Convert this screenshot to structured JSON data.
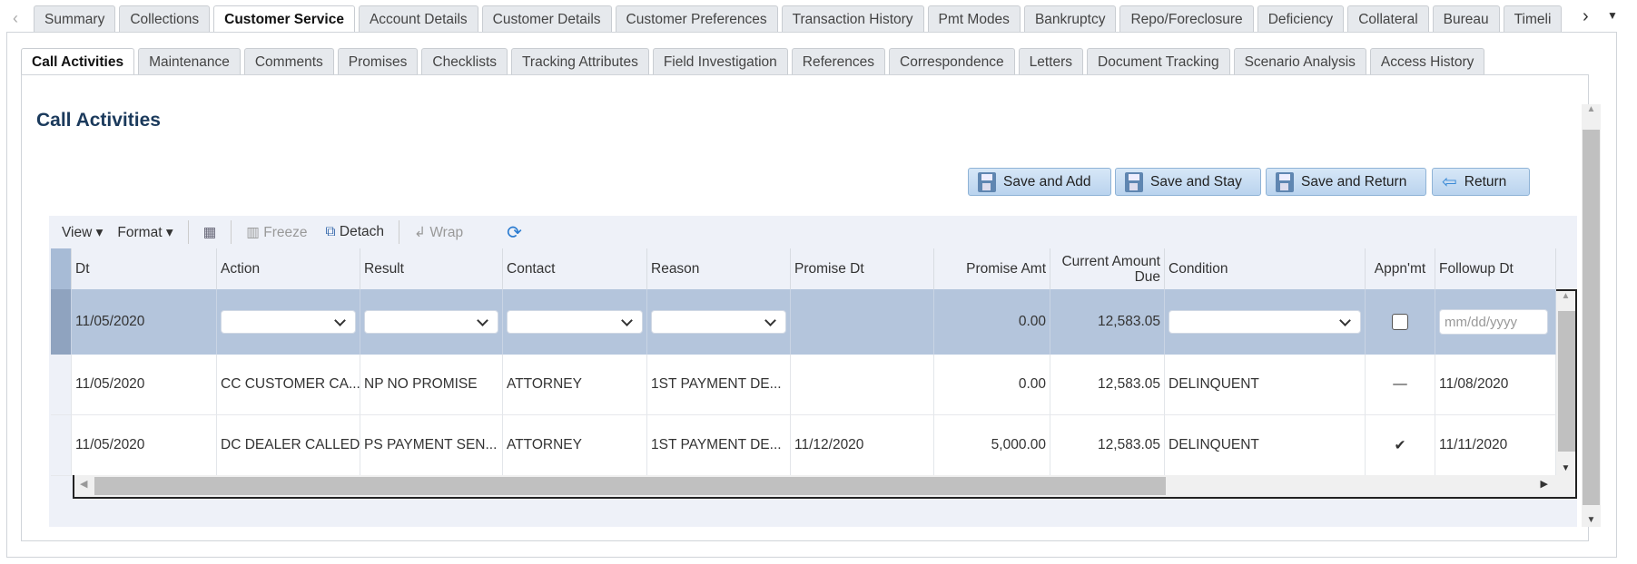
{
  "top_tabs": [
    "Summary",
    "Collections",
    "Customer Service",
    "Account Details",
    "Customer Details",
    "Customer Preferences",
    "Transaction History",
    "Pmt Modes",
    "Bankruptcy",
    "Repo/Foreclosure",
    "Deficiency",
    "Collateral",
    "Bureau",
    "Timeli"
  ],
  "top_active": "Customer Service",
  "sub_tabs": [
    "Call Activities",
    "Maintenance",
    "Comments",
    "Promises",
    "Checklists",
    "Tracking Attributes",
    "Field Investigation",
    "References",
    "Correspondence",
    "Letters",
    "Document Tracking",
    "Scenario Analysis",
    "Access History"
  ],
  "sub_active": "Call Activities",
  "page_title": "Call Activities",
  "buttons": {
    "save_add": "Save and Add",
    "save_stay": "Save and Stay",
    "save_return": "Save and Return",
    "return": "Return"
  },
  "toolbar": {
    "view": "View",
    "format": "Format",
    "freeze": "Freeze",
    "detach": "Detach",
    "wrap": "Wrap"
  },
  "columns": [
    "Dt",
    "Action",
    "Result",
    "Contact",
    "Reason",
    "Promise Dt",
    "Promise Amt",
    "Current Amount Due",
    "Condition",
    "Appn'mt",
    "Followup Dt"
  ],
  "edit_row": {
    "dt": "11/05/2020",
    "promise_amt": "0.00",
    "current_due": "12,583.05",
    "followup_placeholder": "mm/dd/yyyy",
    "appointment": false
  },
  "rows": [
    {
      "dt": "11/05/2020",
      "action": "CC CUSTOMER CA...",
      "result": "NP NO PROMISE",
      "contact": "ATTORNEY",
      "reason": "1ST PAYMENT DE...",
      "promise_dt": "",
      "promise_amt": "0.00",
      "current_due": "12,583.05",
      "condition": "DELINQUENT",
      "appointment": "—",
      "followup": "11/08/2020"
    },
    {
      "dt": "11/05/2020",
      "action": "DC DEALER CALLED",
      "result": "PS PAYMENT SEN...",
      "contact": "ATTORNEY",
      "reason": "1ST PAYMENT DE...",
      "promise_dt": "11/12/2020",
      "promise_amt": "5,000.00",
      "current_due": "12,583.05",
      "condition": "DELINQUENT",
      "appointment": "✔",
      "followup": "11/11/2020"
    }
  ],
  "colors": {
    "selected_row": "#b4c5dc",
    "button": "#c6dcf2",
    "title": "#1b3a5c"
  }
}
